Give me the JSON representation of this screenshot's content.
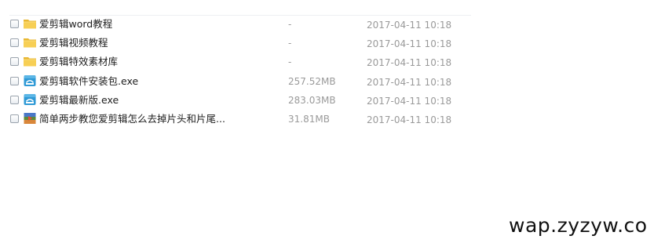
{
  "files": [
    {
      "name": "爱剪辑word教程",
      "size": "-",
      "date": "2017-04-11 10:18",
      "icon": "folder-icon"
    },
    {
      "name": "爱剪辑视频教程",
      "size": "-",
      "date": "2017-04-11 10:18",
      "icon": "folder-icon"
    },
    {
      "name": "爱剪辑特效素材库",
      "size": "-",
      "date": "2017-04-11 10:18",
      "icon": "folder-icon"
    },
    {
      "name": "爱剪辑软件安装包.exe",
      "size": "257.52MB",
      "date": "2017-04-11 10:18",
      "icon": "exe-icon"
    },
    {
      "name": "爱剪辑最新版.exe",
      "size": "283.03MB",
      "date": "2017-04-11 10:18",
      "icon": "exe-icon"
    },
    {
      "name": "简单两步教您爱剪辑怎么去掉片头和片尾...",
      "size": "31.81MB",
      "date": "2017-04-11 10:18",
      "icon": "video-file-icon"
    }
  ],
  "watermark": "wap.zyzyw.co"
}
